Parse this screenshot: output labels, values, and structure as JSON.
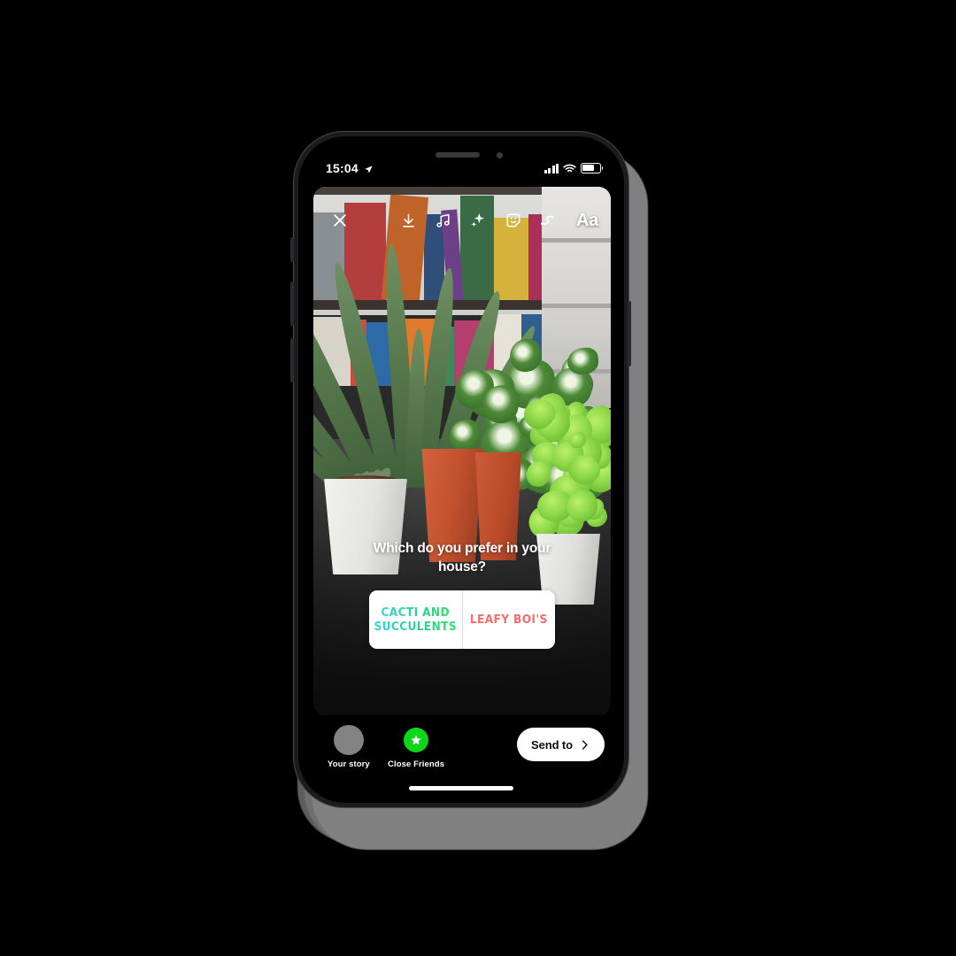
{
  "device": {
    "name": "iphone-x",
    "statusbar": {
      "time": "15:04",
      "location_icon": "location-arrow-icon",
      "signal_icon": "cellular-signal-icon",
      "wifi_icon": "wifi-icon",
      "battery_icon": "battery-icon",
      "battery_level_pct": 70
    },
    "home_indicator": "home-indicator"
  },
  "app": {
    "name": "Instagram Stories",
    "screen": "story-composer",
    "toolbar": {
      "close": {
        "label": "Close",
        "icon": "close-x-icon"
      },
      "items": [
        {
          "label": "Save",
          "icon": "download-icon"
        },
        {
          "label": "Music",
          "icon": "music-note-icon"
        },
        {
          "label": "Effects",
          "icon": "sparkles-icon"
        },
        {
          "label": "Stickers",
          "icon": "sticker-smiley-icon"
        },
        {
          "label": "Draw",
          "icon": "draw-squiggle-icon"
        },
        {
          "label": "Text",
          "icon": "text-aa-icon",
          "text": "Aa"
        }
      ]
    },
    "poll": {
      "question": "Which do you prefer in your house?",
      "options": [
        {
          "label": "CACTI AND SUCCULENTS",
          "color_start": "#2bd8e8",
          "color_end": "#2ee85e"
        },
        {
          "label": "LEAFY BOI'S",
          "color": "#fa6b6b"
        }
      ]
    },
    "share_bar": {
      "your_story": {
        "label": "Your story",
        "avatar": "user-avatar"
      },
      "close_friends": {
        "label": "Close Friends",
        "icon": "green-star-icon",
        "color": "#0fd619"
      },
      "send_to": {
        "label": "Send to",
        "icon": "chevron-right-icon"
      }
    },
    "photo": {
      "description": "Houseplants on a dark table in front of a bookshelf",
      "subjects": [
        "aloe-vera",
        "succulent",
        "syngonium",
        "basil",
        "bookshelf"
      ]
    }
  },
  "colors": {
    "background": "#000000",
    "sticker_white": "#ffffff",
    "close_friends_green": "#0fd619",
    "poll_coral": "#fa6b6b"
  }
}
